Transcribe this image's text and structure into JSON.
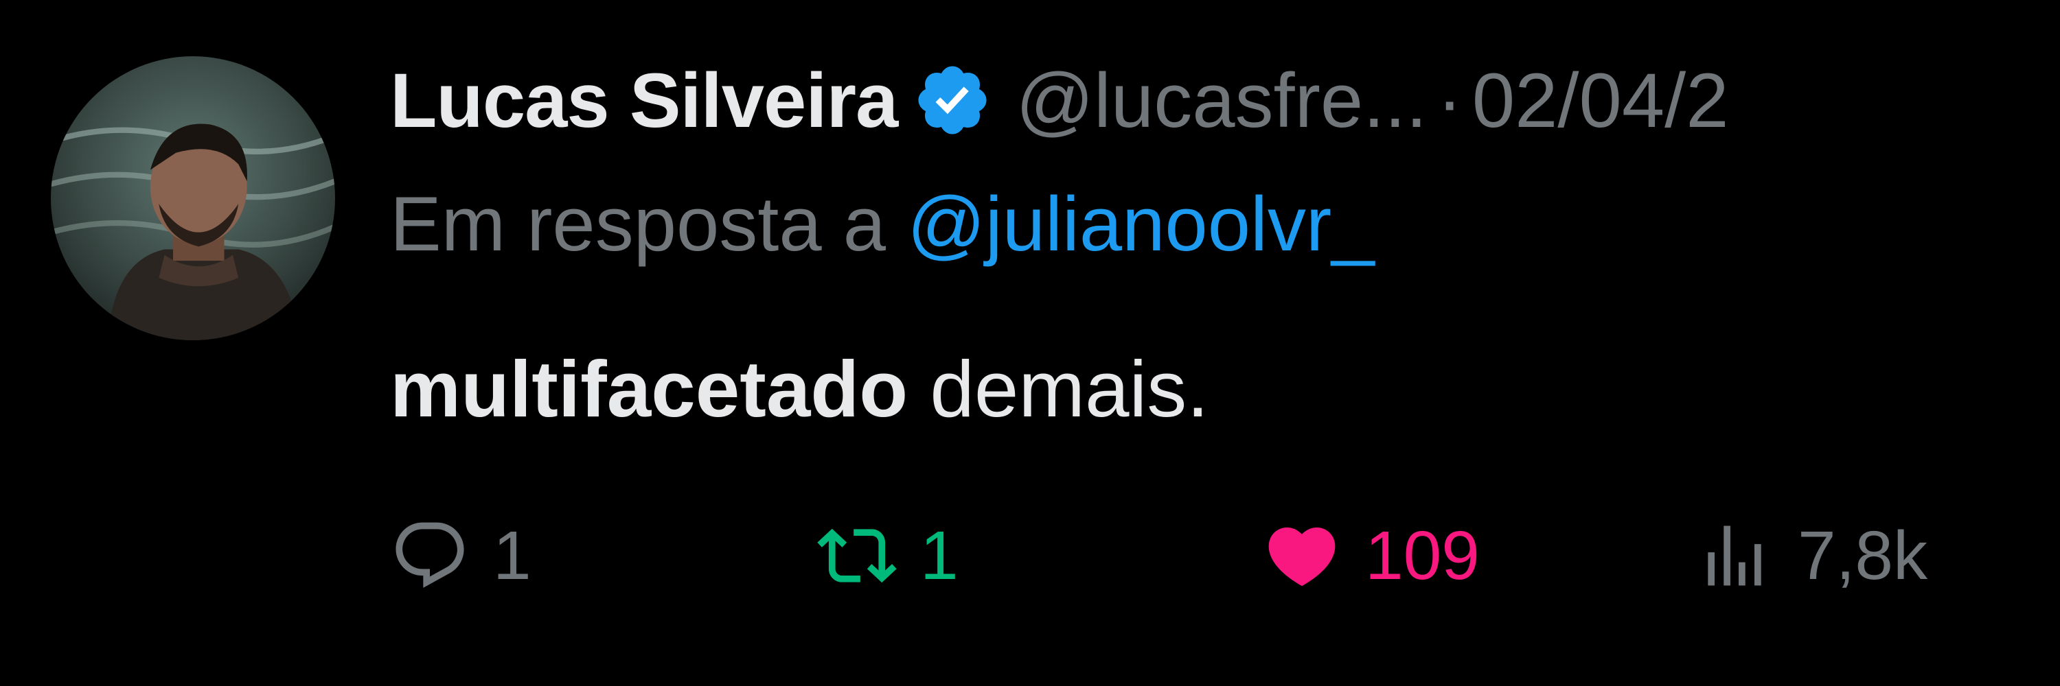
{
  "colors": {
    "background": "#000000",
    "text_primary": "#e7e9ea",
    "text_secondary": "#71767b",
    "link_blue": "#1d9bf0",
    "retweet_green": "#00ba7c",
    "like_pink": "#f91880",
    "verified_blue": "#1d9bf0"
  },
  "author": {
    "display_name": "Lucas Silveira",
    "handle": "@lucasfre...",
    "separator": "·",
    "date": "02/04/2",
    "verified_icon": "verified-badge-icon",
    "avatar_icon": "avatar-photo"
  },
  "reply": {
    "prefix": "Em resposta a ",
    "target": "@julianoolvr_"
  },
  "tweet": {
    "text_bold": "multifacetado",
    "text_rest": " demais."
  },
  "actions": {
    "reply": {
      "icon": "reply-icon",
      "count": "1"
    },
    "retweet": {
      "icon": "retweet-icon",
      "count": "1"
    },
    "like": {
      "icon": "heart-icon",
      "count": "109"
    },
    "views": {
      "icon": "views-icon",
      "count": "7,8k"
    }
  }
}
